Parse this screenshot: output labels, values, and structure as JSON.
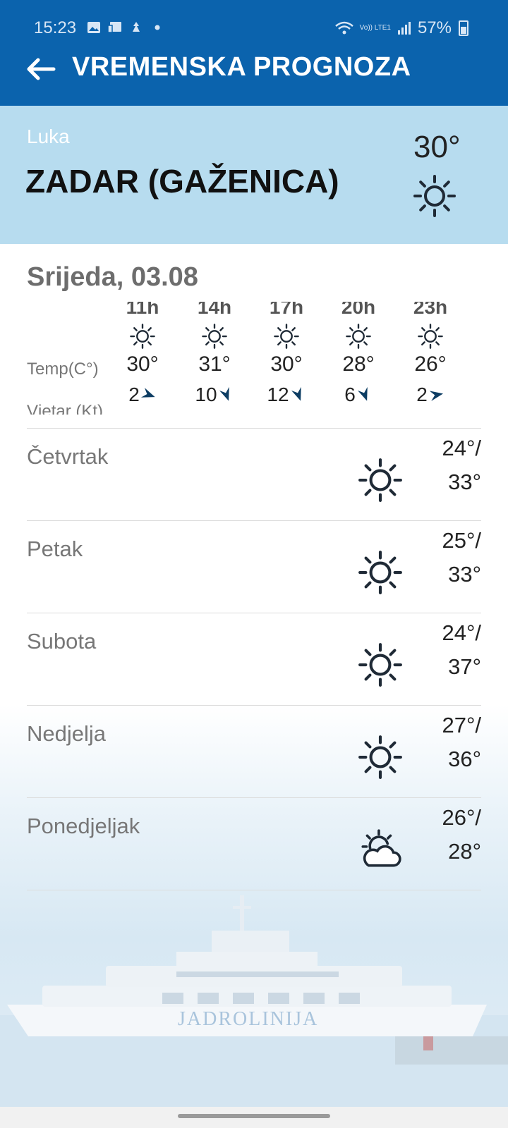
{
  "status_bar": {
    "time": "15:23",
    "network": "Vo)) LTE1",
    "battery": "57%",
    "icons": [
      "gallery-icon",
      "cast-icon",
      "game-icon",
      "dot-icon"
    ]
  },
  "app_bar": {
    "back_icon": "arrow-left-icon",
    "title": "VREMENSKA PROGNOZA",
    "background_color": "#0b63ad"
  },
  "location": {
    "label": "Luka",
    "name": "ZADAR (GAŽENICA)",
    "temp": "30°",
    "icon": "sun-icon",
    "background_color": "#b7dcef"
  },
  "today": {
    "title": "Srijeda, 03.08",
    "temp_label": "Temp(C°)",
    "wind_label": "Vjetar (Kt)",
    "hours": [
      {
        "time": "11h",
        "icon": "sun-icon",
        "temp": "30°",
        "wind": "2",
        "wind_direction_deg": 225
      },
      {
        "time": "14h",
        "icon": "sun-icon",
        "temp": "31°",
        "wind": "10",
        "wind_direction_deg": 315
      },
      {
        "time": "17h",
        "icon": "sun-icon",
        "temp": "30°",
        "wind": "12",
        "wind_direction_deg": 315
      },
      {
        "time": "20h",
        "icon": "sun-icon",
        "temp": "28°",
        "wind": "6",
        "wind_direction_deg": 315
      },
      {
        "time": "23h",
        "icon": "sun-icon",
        "temp": "26°",
        "wind": "2",
        "wind_direction_deg": 270
      }
    ]
  },
  "days": [
    {
      "name": "Četvrtak",
      "icon": "sun-icon",
      "min": "24°/",
      "max": "33°"
    },
    {
      "name": "Petak",
      "icon": "sun-icon",
      "min": "25°/",
      "max": "33°"
    },
    {
      "name": "Subota",
      "icon": "sun-icon",
      "min": "24°/",
      "max": "37°"
    },
    {
      "name": "Nedjelja",
      "icon": "sun-icon",
      "min": "27°/",
      "max": "36°"
    },
    {
      "name": "Ponedjeljak",
      "icon": "partly-cloudy-icon",
      "min": "26°/",
      "max": "28°"
    }
  ],
  "background": {
    "image": "ferry-icon",
    "brand": "JADROLINIJA"
  }
}
